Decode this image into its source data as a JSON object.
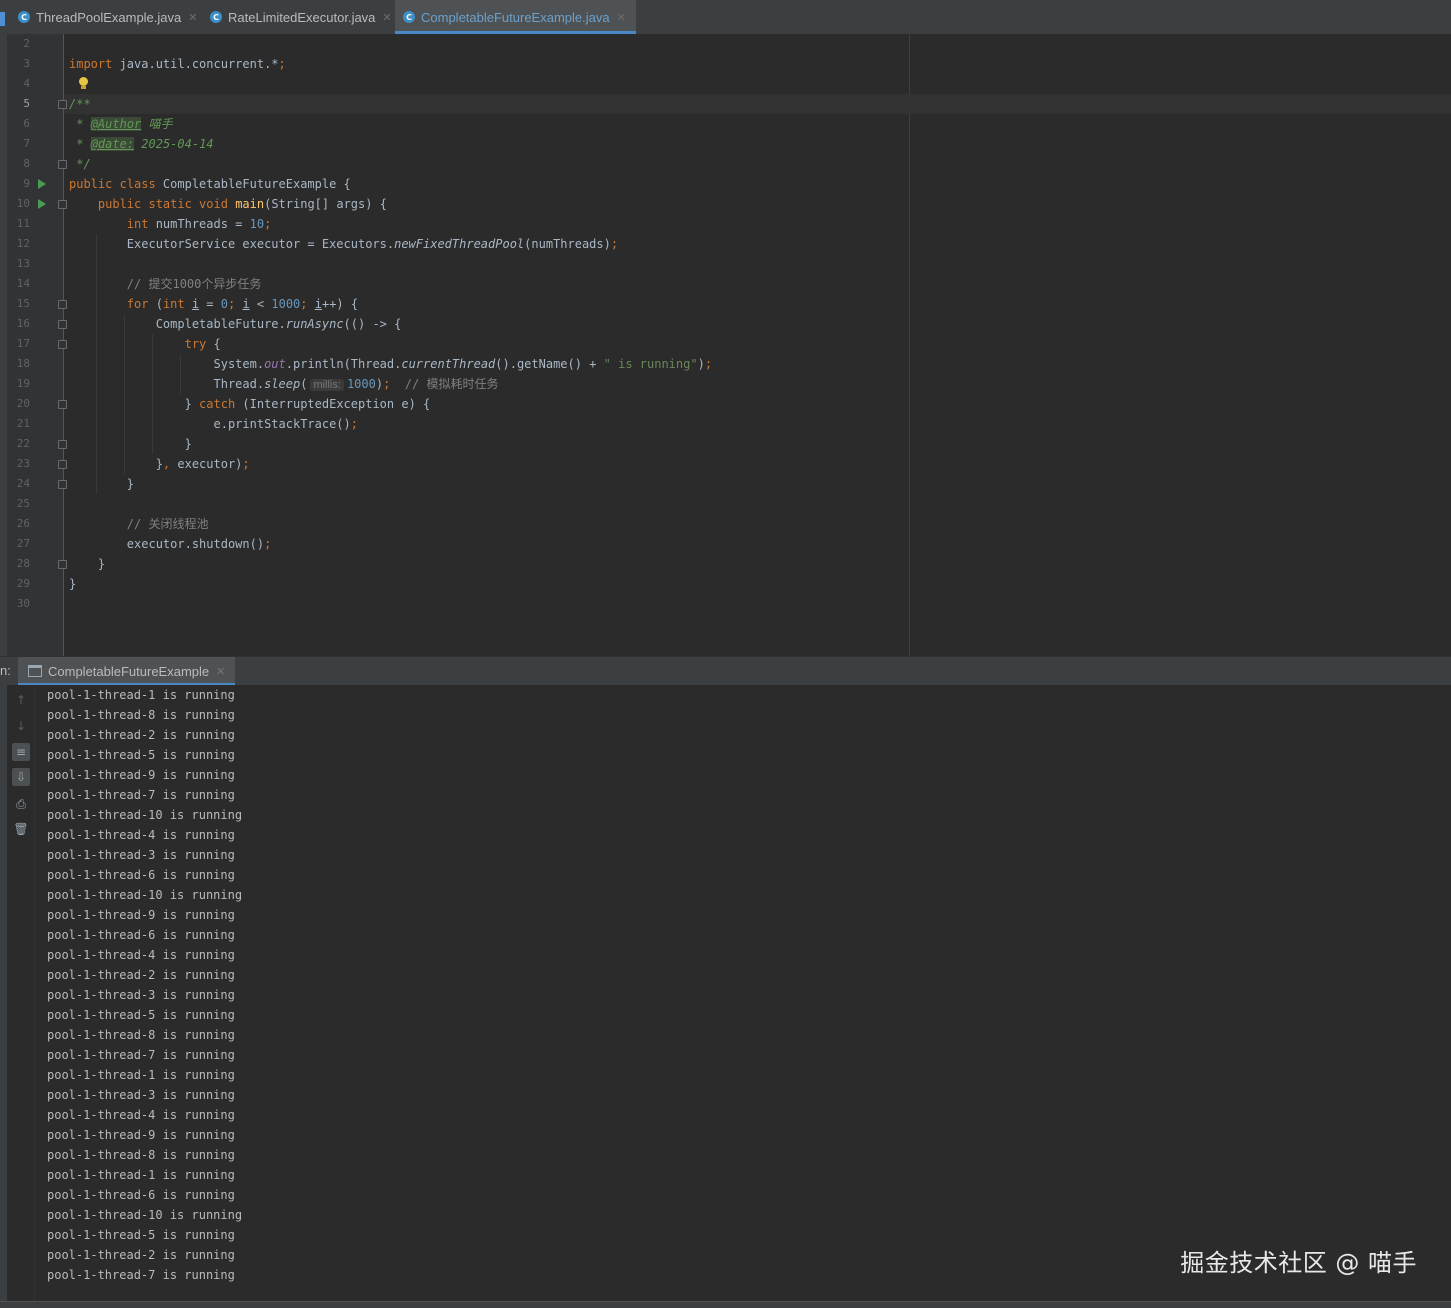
{
  "tabs": [
    {
      "label": "ThreadPoolExample.java",
      "active": false
    },
    {
      "label": "RateLimitedExecutor.java",
      "active": false
    },
    {
      "label": "CompletableFutureExample.java",
      "active": true
    }
  ],
  "editor": {
    "current_line": "5",
    "lines": [
      {
        "n": "2",
        "html": ""
      },
      {
        "n": "3",
        "html": "<span class=\"kw\">import </span>java.util.concurrent.*<span class=\"kw\">;</span>"
      },
      {
        "n": "4",
        "html": ""
      },
      {
        "n": "5",
        "html": "<span class=\"doc\">/**</span>"
      },
      {
        "n": "6",
        "html": "<span class=\"doc\"> * </span><span class=\"tag\">@Author</span><span class=\"doc\"> 喵手</span>"
      },
      {
        "n": "7",
        "html": "<span class=\"doc\"> * </span><span class=\"tag\">@date:</span><span class=\"doc\"> 2025-04-14</span>"
      },
      {
        "n": "8",
        "html": "<span class=\"doc\"> */</span>"
      },
      {
        "n": "9",
        "html": "<span class=\"kw\">public class </span>CompletableFutureExample {"
      },
      {
        "n": "10",
        "html": "    <span class=\"kw\">public static void </span><span class=\"fn\">main</span>(String[] args) {"
      },
      {
        "n": "11",
        "html": "        <span class=\"kw\">int </span>numThreads = <span class=\"num\">10</span><span class=\"kw\">;</span>"
      },
      {
        "n": "12",
        "html": "        ExecutorService executor = Executors.<span class=\"it\">newFixedThreadPool</span>(numThreads)<span class=\"kw\">;</span>"
      },
      {
        "n": "13",
        "html": ""
      },
      {
        "n": "14",
        "html": "        <span class=\"cmt\">// 提交1000个异步任务</span>"
      },
      {
        "n": "15",
        "html": "        <span class=\"kw\">for </span>(<span class=\"kw\">int </span><span class=\"ul\">i</span> = <span class=\"num\">0</span><span class=\"kw\">; </span><span class=\"ul\">i</span> &lt; <span class=\"num\">1000</span><span class=\"kw\">; </span><span class=\"ul\">i</span>++) {"
      },
      {
        "n": "16",
        "html": "            CompletableFuture.<span class=\"it\">runAsync</span>(() -&gt; {"
      },
      {
        "n": "17",
        "html": "                <span class=\"kw\">try </span>{"
      },
      {
        "n": "18",
        "html": "                    System.<span class=\"field\">out</span>.println(Thread.<span class=\"it\">currentThread</span>().getName() + <span class=\"str\">\" is running\"</span>)<span class=\"kw\">;</span>"
      },
      {
        "n": "19",
        "html": "                    Thread.<span class=\"it\">sleep</span>(<span class=\"hint\">millis:</span><span class=\"num\">1000</span>)<span class=\"kw\">;  </span><span class=\"cmt\">// 模拟耗时任务</span>"
      },
      {
        "n": "20",
        "html": "                } <span class=\"kw\">catch </span>(InterruptedException e) {"
      },
      {
        "n": "21",
        "html": "                    e.printStackTrace()<span class=\"kw\">;</span>"
      },
      {
        "n": "22",
        "html": "                }"
      },
      {
        "n": "23",
        "html": "            }<span class=\"kw\">, </span>executor)<span class=\"kw\">;</span>"
      },
      {
        "n": "24",
        "html": "        }"
      },
      {
        "n": "25",
        "html": ""
      },
      {
        "n": "26",
        "html": "        <span class=\"cmt\">// 关闭线程池</span>"
      },
      {
        "n": "27",
        "html": "        executor.shutdown()<span class=\"kw\">;</span>"
      },
      {
        "n": "28",
        "html": "    }"
      },
      {
        "n": "29",
        "html": "}"
      },
      {
        "n": "30",
        "html": ""
      }
    ]
  },
  "run_panel": {
    "prefix": "n:",
    "tab_label": "CompletableFutureExample",
    "output": [
      "pool-1-thread-1 is running",
      "pool-1-thread-8 is running",
      "pool-1-thread-2 is running",
      "pool-1-thread-5 is running",
      "pool-1-thread-9 is running",
      "pool-1-thread-7 is running",
      "pool-1-thread-10 is running",
      "pool-1-thread-4 is running",
      "pool-1-thread-3 is running",
      "pool-1-thread-6 is running",
      "pool-1-thread-10 is running",
      "pool-1-thread-9 is running",
      "pool-1-thread-6 is running",
      "pool-1-thread-4 is running",
      "pool-1-thread-2 is running",
      "pool-1-thread-3 is running",
      "pool-1-thread-5 is running",
      "pool-1-thread-8 is running",
      "pool-1-thread-7 is running",
      "pool-1-thread-1 is running",
      "pool-1-thread-3 is running",
      "pool-1-thread-4 is running",
      "pool-1-thread-9 is running",
      "pool-1-thread-8 is running",
      "pool-1-thread-1 is running",
      "pool-1-thread-6 is running",
      "pool-1-thread-10 is running",
      "pool-1-thread-5 is running",
      "pool-1-thread-2 is running",
      "pool-1-thread-7 is running"
    ]
  },
  "watermark": "掘金技术社区 @ 喵手"
}
